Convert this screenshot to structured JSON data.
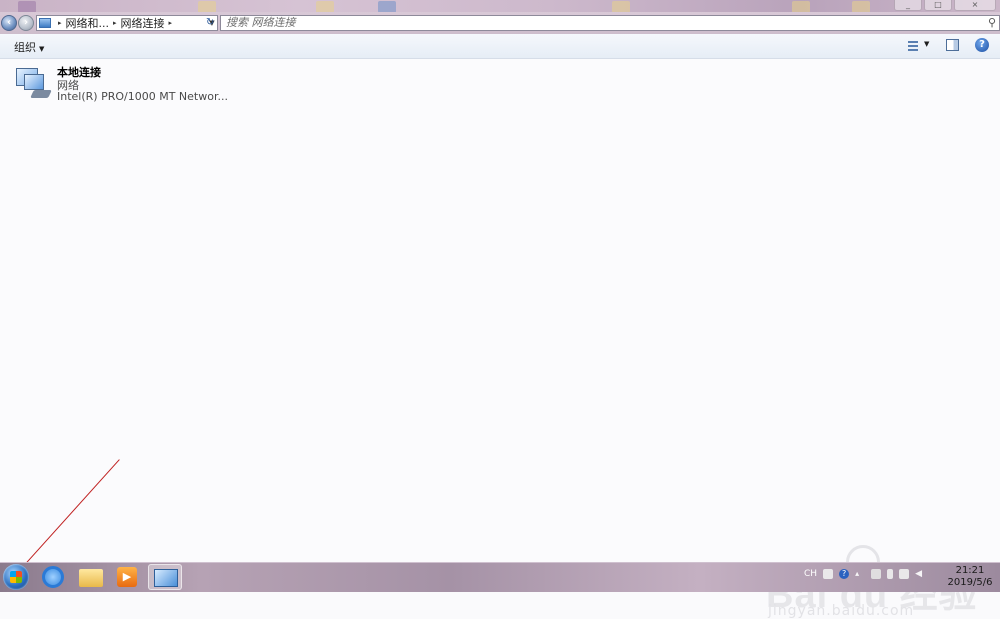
{
  "window": {
    "controls": [
      "_",
      "□",
      "×"
    ]
  },
  "address": {
    "crumbs": [
      "网络和...",
      "网络连接"
    ],
    "search_placeholder": "搜索 网络连接"
  },
  "toolbar": {
    "organize_label": "组织"
  },
  "items": [
    {
      "name": "本地连接",
      "status": "网络",
      "device": "Intel(R) PRO/1000 MT Networ..."
    }
  ],
  "watermark": {
    "brand": "Bai du 经验",
    "url": "jingyan.baidu.com"
  },
  "taskbar": {
    "apps": [
      "internet-explorer",
      "file-explorer",
      "media-player",
      "network-connections"
    ],
    "tray_lang": "CH",
    "time": "21:21",
    "date": "2019/5/6"
  }
}
